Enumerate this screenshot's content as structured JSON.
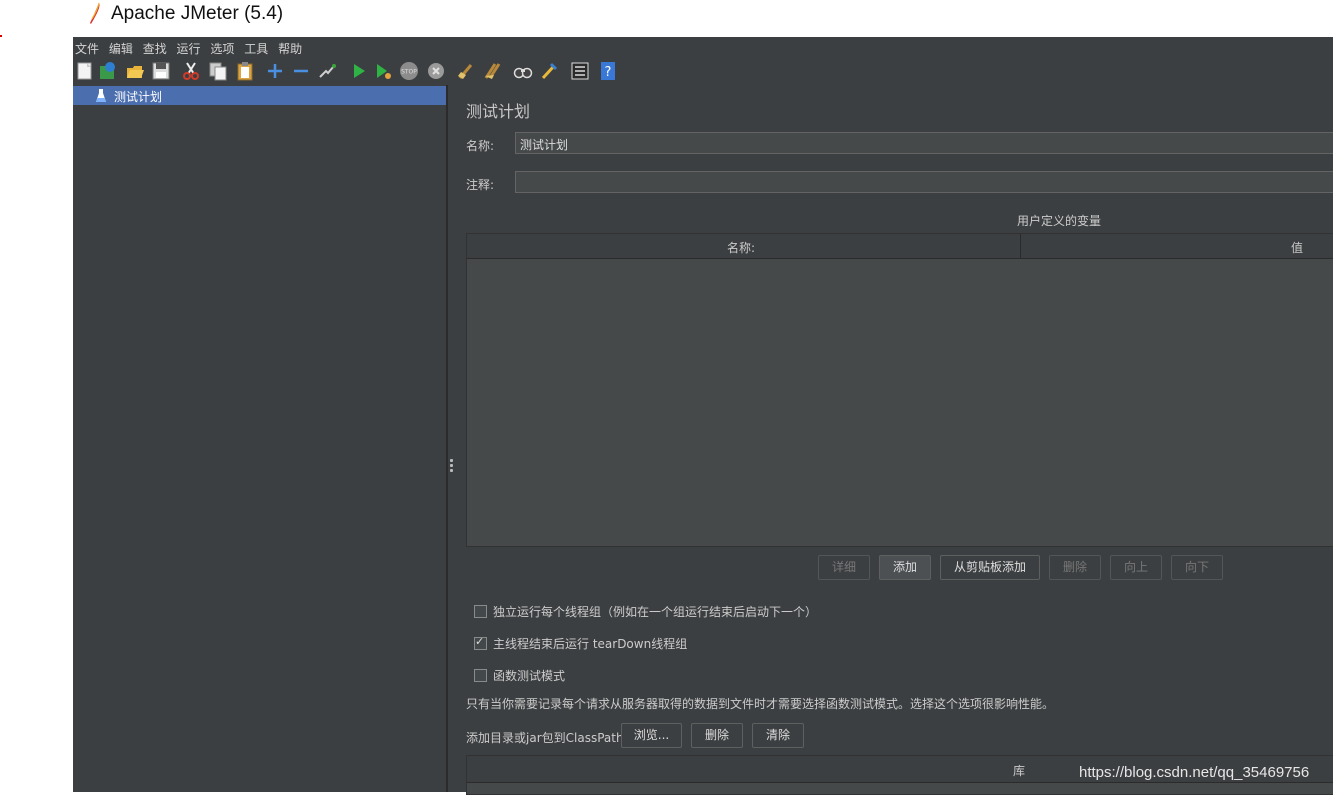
{
  "window": {
    "title": "Apache JMeter (5.4)"
  },
  "menu": [
    "文件",
    "编辑",
    "查找",
    "运行",
    "选项",
    "工具",
    "帮助"
  ],
  "toolbar": {
    "icons": [
      "new-icon",
      "templates-icon",
      "open-icon",
      "save-icon",
      "cut-icon",
      "copy-icon",
      "paste-icon",
      "expand-icon",
      "collapse-icon",
      "toggle-icon",
      "start-icon",
      "start-no-pause-icon",
      "stop-icon",
      "shutdown-icon",
      "clear-icon",
      "clear-all-icon",
      "search-icon",
      "reset-search-icon",
      "function-helper-icon",
      "help-icon"
    ]
  },
  "tree": {
    "items": [
      {
        "label": "测试计划",
        "selected": true
      }
    ]
  },
  "panel": {
    "title": "测试计划",
    "name_label": "名称:",
    "name_value": "测试计划",
    "comment_label": "注释:",
    "comment_value": "",
    "variables_title": "用户定义的变量",
    "columns": [
      "名称:",
      "值"
    ],
    "buttons": [
      {
        "label": "详细",
        "enabled": false
      },
      {
        "label": "添加",
        "enabled": true
      },
      {
        "label": "从剪贴板添加",
        "enabled": true
      },
      {
        "label": "删除",
        "enabled": false
      },
      {
        "label": "向上",
        "enabled": false
      },
      {
        "label": "向下",
        "enabled": false
      }
    ],
    "options": [
      {
        "label": "独立运行每个线程组（例如在一个组运行结束后启动下一个）",
        "checked": false
      },
      {
        "label": "主线程结束后运行 tearDown线程组",
        "checked": true
      },
      {
        "label": "函数测试模式",
        "checked": false
      }
    ],
    "functional_info": "只有当你需要记录每个请求从服务器取得的数据到文件时才需要选择函数测试模式。选择这个选项很影响性能。",
    "classpath_label": "添加目录或jar包到ClassPath",
    "classpath_buttons": [
      "浏览...",
      "删除",
      "清除"
    ],
    "library_column": "库"
  },
  "watermark": "https://blog.csdn.net/qq_35469756"
}
